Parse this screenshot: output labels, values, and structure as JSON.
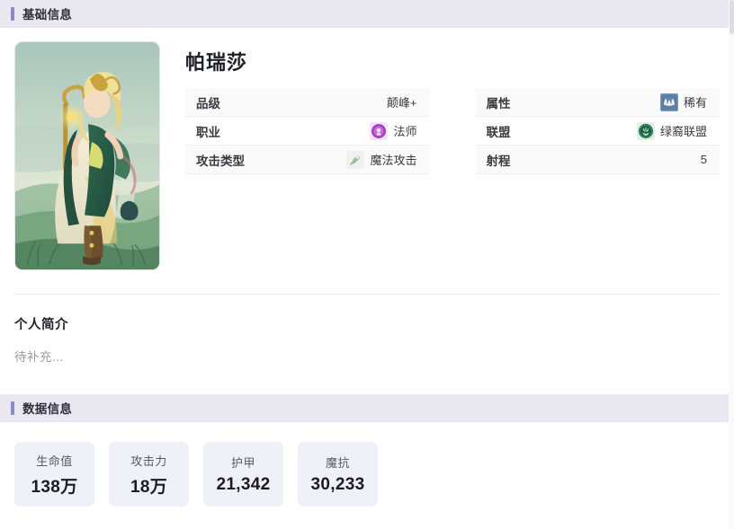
{
  "sections": {
    "basic": {
      "title": "基础信息",
      "accent_color": "#8a8ac6",
      "header_bg": "#e9e7f0"
    },
    "data": {
      "title": "数据信息",
      "accent_color": "#8a8ac6",
      "header_bg": "#e9e7f0"
    }
  },
  "character": {
    "name": "帕瑞莎",
    "portrait_alt": "帕瑞莎立绘"
  },
  "attributes": {
    "left": [
      {
        "label": "品级",
        "value": "颠峰+",
        "icon": null
      },
      {
        "label": "职业",
        "value": "法师",
        "icon": "mage-icon",
        "icon_color": "#a83fc0"
      },
      {
        "label": "攻击类型",
        "value": "魔法攻击",
        "icon": "magic-attack-icon",
        "icon_color": "#8fb39a"
      }
    ],
    "right": [
      {
        "label": "属性",
        "value": "稀有",
        "icon": "rare-icon",
        "icon_color": "#5b7fa6"
      },
      {
        "label": "联盟",
        "value": "绿裔联盟",
        "icon": "green-alliance-icon",
        "icon_color": "#2f8f63"
      },
      {
        "label": "射程",
        "value": "5",
        "icon": null
      }
    ]
  },
  "bio": {
    "title": "个人简介",
    "text": "待补充..."
  },
  "stats": [
    {
      "label": "生命值",
      "value": "138万"
    },
    {
      "label": "攻击力",
      "value": "18万"
    },
    {
      "label": "护甲",
      "value": "21,342"
    },
    {
      "label": "魔抗",
      "value": "30,233"
    }
  ]
}
